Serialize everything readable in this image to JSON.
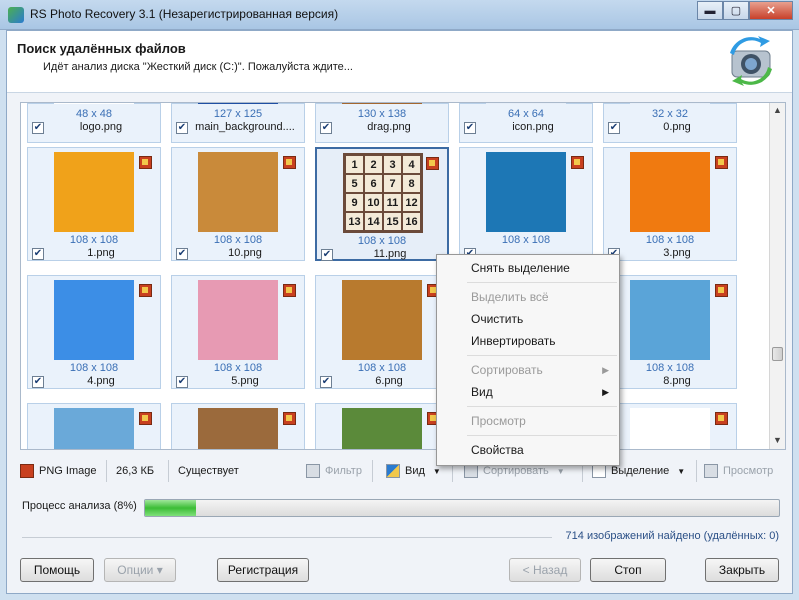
{
  "window": {
    "title": "RS Photo Recovery 3.1 (Незарегистрированная версия)",
    "controls": {
      "minimize": "▬",
      "maximize": "▢",
      "close": "✕"
    }
  },
  "header": {
    "title": "Поиск удалённых файлов",
    "subtitle": "Идёт анализ диска \"Жесткий диск (C:)\". Пожалуйста ждите..."
  },
  "tiles": [
    {
      "dims": "48 x 48",
      "name": "logo.png",
      "checked": true,
      "color": "#ffffff"
    },
    {
      "dims": "127 x 125",
      "name": "main_background....",
      "checked": true,
      "color": "#1f4fa3"
    },
    {
      "dims": "130 x 138",
      "name": "drag.png",
      "checked": true,
      "color": "#a4672f"
    },
    {
      "dims": "64 x 64",
      "name": "icon.png",
      "checked": true,
      "color": "#e6eef8"
    },
    {
      "dims": "32 x 32",
      "name": "0.png",
      "checked": true,
      "color": "#e6eef8"
    },
    {
      "dims": "108 x 108",
      "name": "1.png",
      "checked": true,
      "color": "#f0a21a"
    },
    {
      "dims": "108 x 108",
      "name": "10.png",
      "checked": true,
      "color": "#c98a3a"
    },
    {
      "dims": "108 x 108",
      "name": "11.png",
      "checked": true,
      "color": "#6b4a3a",
      "selected": true
    },
    {
      "dims": "108 x 108",
      "name": "",
      "checked": true,
      "color": "#1d77b5"
    },
    {
      "dims": "108 x 108",
      "name": "3.png",
      "checked": true,
      "color": "#f07a10"
    },
    {
      "dims": "108 x 108",
      "name": "4.png",
      "checked": true,
      "color": "#3c8ee6"
    },
    {
      "dims": "108 x 108",
      "name": "5.png",
      "checked": true,
      "color": "#e79ab3"
    },
    {
      "dims": "108 x 108",
      "name": "6.png",
      "checked": true,
      "color": "#b87a2e"
    },
    {
      "dims": "",
      "name": "",
      "checked": false,
      "color": "#ffffff"
    },
    {
      "dims": "108 x 108",
      "name": "8.png",
      "checked": true,
      "color": "#5aa4d8"
    },
    {
      "dims": "",
      "name": "",
      "checked": false,
      "color": "#6aa9d9"
    },
    {
      "dims": "",
      "name": "",
      "checked": false,
      "color": "#9b6a3c"
    },
    {
      "dims": "",
      "name": "",
      "checked": false,
      "color": "#5b8a3a"
    },
    {
      "dims": "",
      "name": "",
      "checked": false,
      "color": "#ffffff"
    },
    {
      "dims": "",
      "name": "",
      "checked": false,
      "color": "#ffffff"
    }
  ],
  "context_menu": {
    "items": [
      {
        "label": "Снять выделение",
        "enabled": true
      },
      {
        "sep": true
      },
      {
        "label": "Выделить всё",
        "enabled": false
      },
      {
        "label": "Очистить",
        "enabled": true
      },
      {
        "label": "Инвертировать",
        "enabled": true
      },
      {
        "sep": true
      },
      {
        "label": "Сортировать",
        "enabled": false,
        "submenu": true
      },
      {
        "label": "Вид",
        "enabled": true,
        "submenu": true
      },
      {
        "sep": true
      },
      {
        "label": "Просмотр",
        "enabled": false
      },
      {
        "sep": true
      },
      {
        "label": "Свойства",
        "enabled": true
      }
    ]
  },
  "toolbar": {
    "file_type": "PNG Image",
    "file_size": "26,3 КБ",
    "status": "Существует",
    "filter": "Фильтр",
    "view": "Вид",
    "sort": "Сортировать",
    "selection": "Выделение",
    "preview": "Просмотр"
  },
  "progress": {
    "label": "Процесс анализа (8%)",
    "percent": 8
  },
  "found_text": "714 изображений найдено (удалённых: 0)",
  "buttons": {
    "help": "Помощь",
    "options": "Опции ▾",
    "register": "Регистрация",
    "back": "< Назад",
    "stop": "Стоп",
    "close": "Закрыть"
  },
  "colors": {
    "accent": "#3a6fb5",
    "progress": "#3cbd36",
    "selection_border": "#3d6ba3"
  }
}
